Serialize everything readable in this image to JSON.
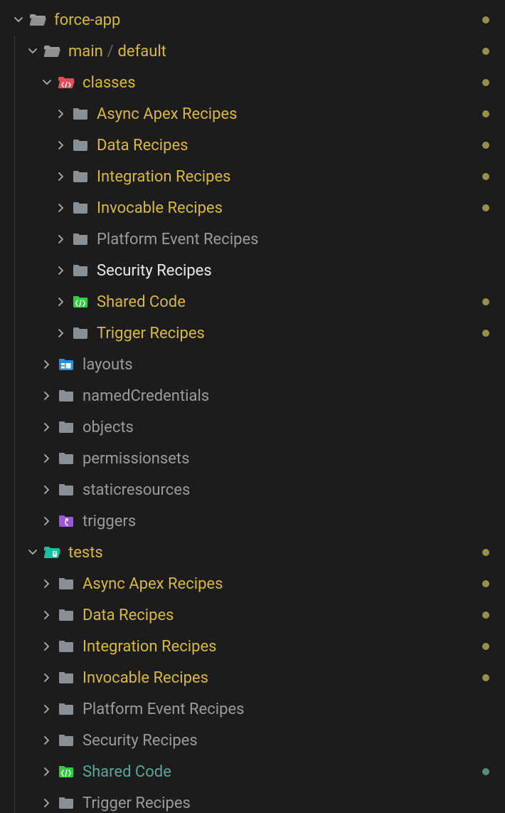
{
  "tree": {
    "guide_x": [
      20
    ],
    "rows": [
      {
        "indent": 0,
        "expanded": true,
        "icon": "folder-open",
        "iconColor": "#9b9b9b",
        "labelParts": [
          {
            "t": "force-app",
            "c": "c-modified"
          }
        ],
        "status": "modified",
        "name": "folder-force-app"
      },
      {
        "indent": 1,
        "expanded": true,
        "icon": "folder-open",
        "iconColor": "#9b9b9b",
        "labelParts": [
          {
            "t": "main",
            "c": "c-modified"
          },
          {
            "sep": "/"
          },
          {
            "t": "default",
            "c": "c-modified"
          }
        ],
        "status": "modified",
        "name": "folder-main-default"
      },
      {
        "indent": 2,
        "expanded": true,
        "icon": "folder-code-open",
        "iconColor": "#e84b55",
        "labelParts": [
          {
            "t": "classes",
            "c": "c-modified"
          }
        ],
        "status": "modified",
        "name": "folder-classes"
      },
      {
        "indent": 3,
        "expanded": false,
        "icon": "folder",
        "iconColor": "#8a8f94",
        "labelParts": [
          {
            "t": "Async Apex Recipes",
            "c": "c-modified"
          }
        ],
        "status": "modified",
        "name": "folder-async-apex-recipes"
      },
      {
        "indent": 3,
        "expanded": false,
        "icon": "folder",
        "iconColor": "#8a8f94",
        "labelParts": [
          {
            "t": "Data Recipes",
            "c": "c-modified"
          }
        ],
        "status": "modified",
        "name": "folder-data-recipes"
      },
      {
        "indent": 3,
        "expanded": false,
        "icon": "folder",
        "iconColor": "#8a8f94",
        "labelParts": [
          {
            "t": "Integration Recipes",
            "c": "c-modified"
          }
        ],
        "status": "modified",
        "name": "folder-integration-recipes"
      },
      {
        "indent": 3,
        "expanded": false,
        "icon": "folder",
        "iconColor": "#8a8f94",
        "labelParts": [
          {
            "t": "Invocable Recipes",
            "c": "c-modified"
          }
        ],
        "status": "modified",
        "name": "folder-invocable-recipes"
      },
      {
        "indent": 3,
        "expanded": false,
        "icon": "folder",
        "iconColor": "#8a8f94",
        "labelParts": [
          {
            "t": "Platform Event Recipes",
            "c": "c-default"
          }
        ],
        "status": null,
        "name": "folder-platform-event-recipes"
      },
      {
        "indent": 3,
        "expanded": false,
        "icon": "folder",
        "iconColor": "#8a8f94",
        "labelParts": [
          {
            "t": "Security Recipes",
            "c": "c-white"
          }
        ],
        "status": null,
        "name": "folder-security-recipes"
      },
      {
        "indent": 3,
        "expanded": false,
        "icon": "folder-code",
        "iconColor": "#2ecc40",
        "labelParts": [
          {
            "t": "Shared Code",
            "c": "c-modified"
          }
        ],
        "status": "modified",
        "name": "folder-shared-code"
      },
      {
        "indent": 3,
        "expanded": false,
        "icon": "folder",
        "iconColor": "#8a8f94",
        "labelParts": [
          {
            "t": "Trigger Recipes",
            "c": "c-modified"
          }
        ],
        "status": "modified",
        "name": "folder-trigger-recipes"
      },
      {
        "indent": 2,
        "expanded": false,
        "icon": "folder-layouts",
        "iconColor": "#2b8ed6",
        "labelParts": [
          {
            "t": "layouts",
            "c": "c-default"
          }
        ],
        "status": null,
        "name": "folder-layouts"
      },
      {
        "indent": 2,
        "expanded": false,
        "icon": "folder",
        "iconColor": "#8a8f94",
        "labelParts": [
          {
            "t": "namedCredentials",
            "c": "c-default"
          }
        ],
        "status": null,
        "name": "folder-named-credentials"
      },
      {
        "indent": 2,
        "expanded": false,
        "icon": "folder",
        "iconColor": "#8a8f94",
        "labelParts": [
          {
            "t": "objects",
            "c": "c-default"
          }
        ],
        "status": null,
        "name": "folder-objects"
      },
      {
        "indent": 2,
        "expanded": false,
        "icon": "folder",
        "iconColor": "#8a8f94",
        "labelParts": [
          {
            "t": "permissionsets",
            "c": "c-default"
          }
        ],
        "status": null,
        "name": "folder-permissionsets"
      },
      {
        "indent": 2,
        "expanded": false,
        "icon": "folder",
        "iconColor": "#8a8f94",
        "labelParts": [
          {
            "t": "staticresources",
            "c": "c-default"
          }
        ],
        "status": null,
        "name": "folder-staticresources"
      },
      {
        "indent": 2,
        "expanded": false,
        "icon": "folder-triggers",
        "iconColor": "#9b59d6",
        "labelParts": [
          {
            "t": "triggers",
            "c": "c-default"
          }
        ],
        "status": null,
        "name": "folder-triggers"
      },
      {
        "indent": 1,
        "expanded": true,
        "icon": "folder-tests-open",
        "iconColor": "#16c0a0",
        "labelParts": [
          {
            "t": "tests",
            "c": "c-modified"
          }
        ],
        "status": "modified",
        "name": "folder-tests"
      },
      {
        "indent": 2,
        "expanded": false,
        "icon": "folder",
        "iconColor": "#8a8f94",
        "labelParts": [
          {
            "t": "Async Apex Recipes",
            "c": "c-modified"
          }
        ],
        "status": "modified",
        "name": "folder-tests-async-apex-recipes"
      },
      {
        "indent": 2,
        "expanded": false,
        "icon": "folder",
        "iconColor": "#8a8f94",
        "labelParts": [
          {
            "t": "Data Recipes",
            "c": "c-modified"
          }
        ],
        "status": "modified",
        "name": "folder-tests-data-recipes"
      },
      {
        "indent": 2,
        "expanded": false,
        "icon": "folder",
        "iconColor": "#8a8f94",
        "labelParts": [
          {
            "t": "Integration Recipes",
            "c": "c-modified"
          }
        ],
        "status": "modified",
        "name": "folder-tests-integration-recipes"
      },
      {
        "indent": 2,
        "expanded": false,
        "icon": "folder",
        "iconColor": "#8a8f94",
        "labelParts": [
          {
            "t": "Invocable Recipes",
            "c": "c-modified"
          }
        ],
        "status": "modified",
        "name": "folder-tests-invocable-recipes"
      },
      {
        "indent": 2,
        "expanded": false,
        "icon": "folder",
        "iconColor": "#8a8f94",
        "labelParts": [
          {
            "t": "Platform Event Recipes",
            "c": "c-default"
          }
        ],
        "status": null,
        "name": "folder-tests-platform-event-recipes"
      },
      {
        "indent": 2,
        "expanded": false,
        "icon": "folder",
        "iconColor": "#8a8f94",
        "labelParts": [
          {
            "t": "Security Recipes",
            "c": "c-default"
          }
        ],
        "status": null,
        "name": "folder-tests-security-recipes"
      },
      {
        "indent": 2,
        "expanded": false,
        "icon": "folder-code",
        "iconColor": "#2ecc40",
        "labelParts": [
          {
            "t": "Shared Code",
            "c": "c-untracked"
          }
        ],
        "status": "untracked",
        "name": "folder-tests-shared-code"
      },
      {
        "indent": 2,
        "expanded": false,
        "icon": "folder",
        "iconColor": "#8a8f94",
        "labelParts": [
          {
            "t": "Trigger Recipes",
            "c": "c-default"
          }
        ],
        "status": null,
        "name": "folder-tests-trigger-recipes"
      }
    ]
  },
  "indentPx": 20,
  "baseLeftPx": 16
}
